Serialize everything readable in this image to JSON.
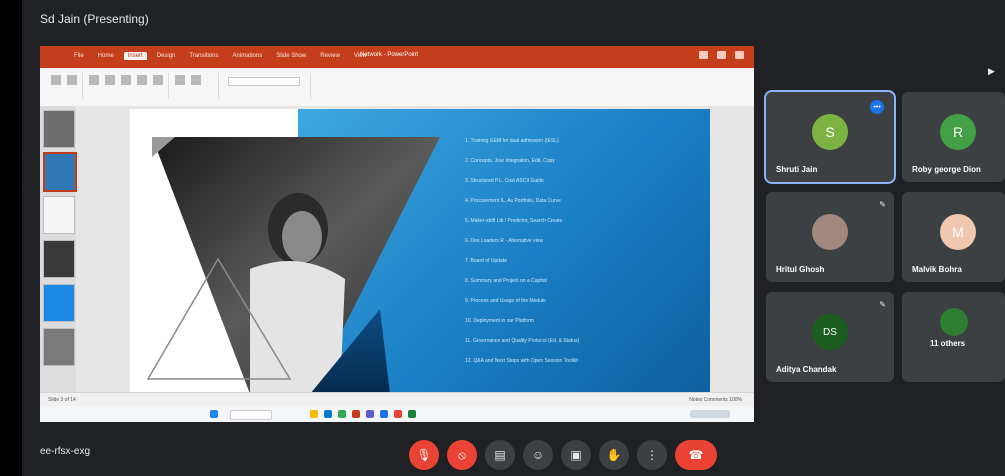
{
  "meeting": {
    "presenter_title": "Sd Jain (Presenting)",
    "meeting_code": "ee-rfsx-exg"
  },
  "presentation": {
    "doc_title": "Network - PowerPoint",
    "tabs": [
      "File",
      "Home",
      "Insert",
      "Design",
      "Transitions",
      "Animations",
      "Slide Show",
      "Review",
      "View"
    ],
    "active_tab": "Insert",
    "slide_lines": [
      "1. Training GEM for dual admission (IESL)",
      "2. Concepts, Jour integration, Edit, Copy",
      "3. Structured P.L. Cost ASCII Guide",
      "4. Procurement IL, As Portfolio, Data Curve",
      "5. Maker-shift Lib / Predictor, Search Create",
      "6. Des Loaders R - Alternative view",
      "7. Board of Update",
      "8. Summary and Project on a Capital",
      "9. Process and Usage of the Module",
      "10. Deployment in our Platform",
      "11. Governance and Quality Protocol (Ed. & Status)",
      "12. Q&A and Next Steps with Open Session Toolkit"
    ],
    "status_left": "Slide 3 of 14",
    "status_right": "Notes  Comments  100%"
  },
  "participants": [
    {
      "name": "Shruti Jain",
      "initial": "S",
      "color": "#7cb342",
      "speaking": true
    },
    {
      "name": "Roby george Dion",
      "initial": "R",
      "color": "#43a047",
      "speaking": false
    },
    {
      "name": "Hritul Ghosh",
      "initial": "",
      "color": "#a1887f",
      "speaking": false
    },
    {
      "name": "Malvik Bohra",
      "initial": "M",
      "color": "#f0c8b0",
      "speaking": false
    },
    {
      "name": "Aditya Chandak",
      "initial": "DS",
      "color": "#1b5e20",
      "speaking": false
    },
    {
      "name": "11 others",
      "initial": "",
      "color": "#2e7d32",
      "speaking": false
    }
  ],
  "controls": {
    "icons": [
      "mic-off-icon",
      "camera-off-icon",
      "captions-icon",
      "emoji-icon",
      "present-icon",
      "raise-hand-icon",
      "more-icon",
      "end-call-icon"
    ],
    "glyphs": [
      "🎙",
      "⦸",
      "▤",
      "☺",
      "▣",
      "✋",
      "⋮",
      "☎"
    ]
  },
  "colors": {
    "ppt_accent": "#c43e1c",
    "end_call": "#ea4335",
    "active_tile": "#8ab4f8"
  }
}
